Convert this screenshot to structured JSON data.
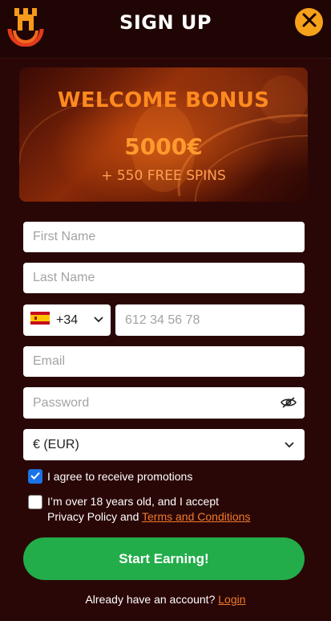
{
  "header": {
    "title": "SIGN UP"
  },
  "banner": {
    "title": "WELCOME BONUS",
    "amount": "5000€",
    "spins": "+ 550 FREE SPINS"
  },
  "form": {
    "first_name_placeholder": "First Name",
    "last_name_placeholder": "Last Name",
    "phone_code": "+34",
    "phone_placeholder": "612 34 56 78",
    "email_placeholder": "Email",
    "password_placeholder": "Password",
    "currency": "€ (EUR)"
  },
  "consents": {
    "promotions_label": "I agree to receive promotions",
    "promotions_checked": true,
    "age_line1": "I’m over 18 years old, and I accept",
    "age_line2_prefix": "Privacy Policy and ",
    "terms_link": "Terms and Conditions",
    "age_checked": false
  },
  "cta": {
    "label": "Start Earning!"
  },
  "footer": {
    "prompt": "Already have an account? ",
    "login_link": "Login"
  },
  "colors": {
    "background": "#2a0707",
    "accent_orange": "#f5a11a",
    "cta_green": "#22ad4a",
    "link_orange": "#f07a2a"
  },
  "icons": [
    "castle-logo-icon",
    "close-icon",
    "spain-flag-icon",
    "chevron-down-icon",
    "eye-slash-icon",
    "checkmark-icon"
  ]
}
